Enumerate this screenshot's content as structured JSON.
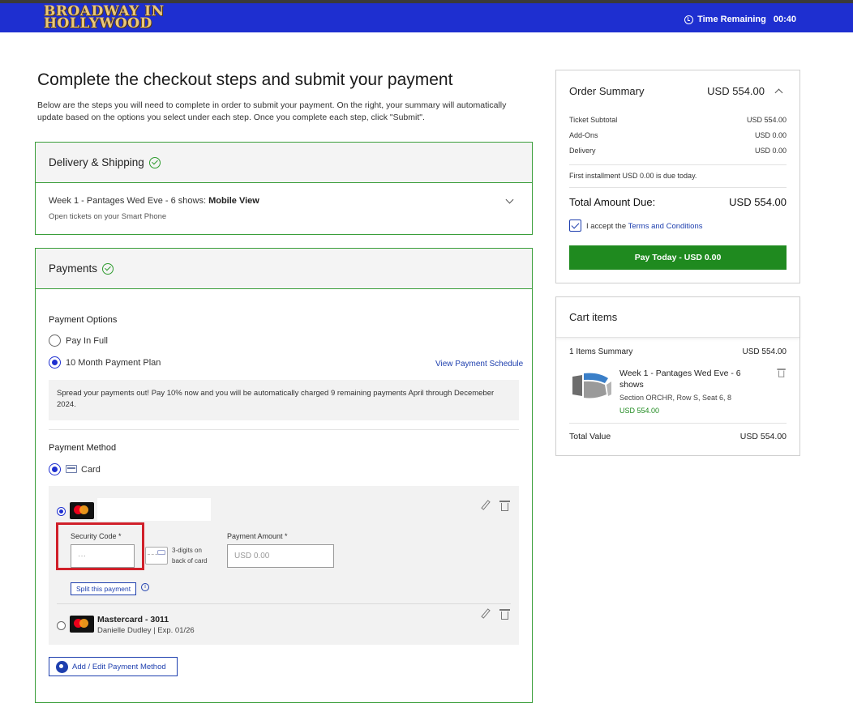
{
  "header": {
    "logo_text": "BROADWAY IN\nHOLLYWOOD",
    "timer_label": "Time Remaining",
    "timer_value": "00:40"
  },
  "main": {
    "title": "Complete the checkout steps and submit your payment",
    "description": "Below are the steps you will need to complete in order to submit your payment. On the right, your summary will automatically update based on the options you select under each step. Once you complete each step, click \"Submit\"."
  },
  "delivery": {
    "title": "Delivery & Shipping",
    "item_prefix": "Week 1 - Pantages Wed Eve - 6 shows: ",
    "item_method": "Mobile View",
    "item_sub": "Open tickets on your Smart Phone"
  },
  "payments": {
    "title": "Payments",
    "options_label": "Payment Options",
    "option_full": "Pay In Full",
    "option_plan": "10 Month Payment Plan",
    "schedule_link": "View Payment Schedule",
    "plan_info": "Spread your payments out! Pay 10% now and you will be automatically charged 9 remaining payments April through Decemeber 2024.",
    "method_label": "Payment Method",
    "method_card": "Card",
    "security_label": "Security Code *",
    "security_placeholder": "···",
    "cvv_note": "3-digits on\nback of card",
    "amount_label": "Payment Amount *",
    "amount_placeholder": "USD 0.00",
    "split_button": "Split this payment",
    "info_glyph": "i",
    "card2_name": "Mastercard - 3011",
    "card2_detail": "Danielle Dudley | Exp. 01/26",
    "add_edit_button": "Add / Edit Payment Method"
  },
  "summary": {
    "title": "Order Summary",
    "amount": "USD 554.00",
    "rows": [
      {
        "label": "Ticket Subtotal",
        "value": "USD 554.00"
      },
      {
        "label": "Add-Ons",
        "value": "USD 0.00"
      },
      {
        "label": "Delivery",
        "value": "USD 0.00"
      }
    ],
    "installment_note": "First installment USD 0.00 is due today.",
    "total_label": "Total Amount Due:",
    "total_value": "USD 554.00",
    "terms_prefix": "I accept the ",
    "terms_link": "Terms and Conditions",
    "pay_button": "Pay Today - USD 0.00"
  },
  "cart": {
    "title": "Cart items",
    "summary_label": "1 Items Summary",
    "summary_value": "USD 554.00",
    "item_title": "Week 1 - Pantages Wed Eve - 6 shows",
    "item_section": "Section ORCHR, Row S, Seat 6, 8",
    "item_price": "USD 554.00",
    "total_label": "Total Value",
    "total_value": "USD 554.00"
  },
  "colors": {
    "brand_blue": "#1e2fd0",
    "success_green": "#1f8a1f",
    "section_border": "#3a9e3a",
    "highlight_red": "#d0202a"
  }
}
